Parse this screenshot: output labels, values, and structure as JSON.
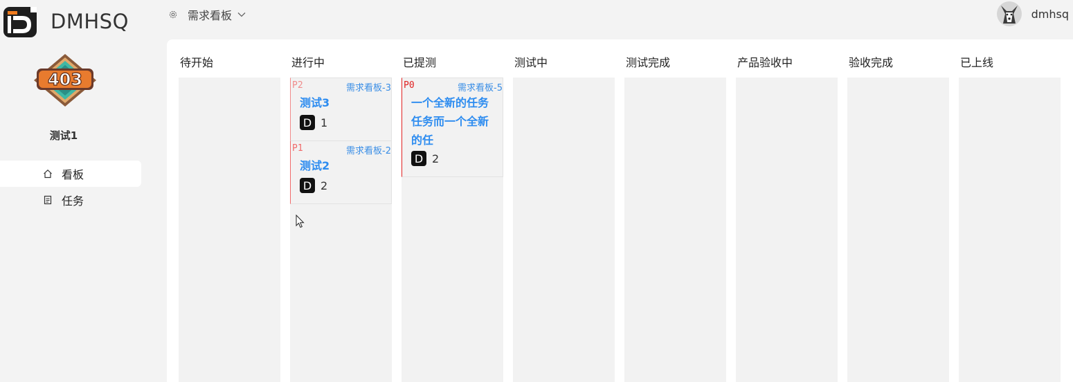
{
  "app": {
    "name": "DMHSQ"
  },
  "header": {
    "board_menu_label": "需求看板",
    "username": "dmhsq"
  },
  "sidebar": {
    "badge_text": "403",
    "project_name": "测试1",
    "items": [
      {
        "label": "看板",
        "icon": "home-icon",
        "active": true
      },
      {
        "label": "任务",
        "icon": "document-icon",
        "active": false
      }
    ]
  },
  "board": {
    "columns": [
      {
        "title": "待开始"
      },
      {
        "title": "进行中"
      },
      {
        "title": "已提测"
      },
      {
        "title": "测试中"
      },
      {
        "title": "测试完成"
      },
      {
        "title": "产品验收中"
      },
      {
        "title": "验收完成"
      },
      {
        "title": "已上线"
      }
    ],
    "cards": [
      {
        "priority": "P2",
        "key": "需求看板-3",
        "title": "测试3",
        "count": "1",
        "column": 1,
        "priority_color": "#f08a8a"
      },
      {
        "priority": "P1",
        "key": "需求看板-2",
        "title": "测试2",
        "count": "2",
        "column": 1,
        "priority_color": "#f06a6a"
      },
      {
        "priority": "P0",
        "key": "需求看板-5",
        "title": "一个全新的任务任务而一个全新的任",
        "count": "2",
        "column": 2,
        "priority_color": "#e02020"
      }
    ]
  },
  "colors": {
    "accent": "#2d8cf0",
    "link": "#3a8ee6",
    "p0": "#e02020"
  }
}
